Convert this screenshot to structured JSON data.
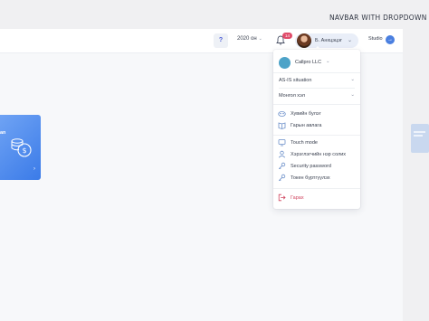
{
  "caption": "NAVBAR WITH DROPDOWN",
  "navbar": {
    "help_label": "?",
    "year": "2020 он",
    "notification_count": "14",
    "user_name": "Б. Анхцэцэг",
    "studio_label": "Studio"
  },
  "side_card": {
    "label": "an"
  },
  "dropdown": {
    "company": "Callpro LLC",
    "selects": [
      {
        "label": "AS-IS situation"
      },
      {
        "label": "Монгол хэл"
      }
    ],
    "items": [
      {
        "label": "Хувийн булэг",
        "icon": "group-icon"
      },
      {
        "label": "Гарын авлага",
        "icon": "book-icon"
      },
      {
        "label": "Touch mode",
        "icon": "touch-icon"
      },
      {
        "label": "Хэрэглэгчийн нэр солих",
        "icon": "user-icon"
      },
      {
        "label": "Security password",
        "icon": "key-icon"
      },
      {
        "label": "Токен бүртгүүлэх",
        "icon": "key-icon"
      }
    ],
    "logout": {
      "label": "Гарах",
      "icon": "logout-icon"
    }
  },
  "colors": {
    "accent": "#4a7fe0",
    "card_blue": "#3b7be8",
    "badge": "#e04c6a",
    "logout": "#d0455f"
  }
}
